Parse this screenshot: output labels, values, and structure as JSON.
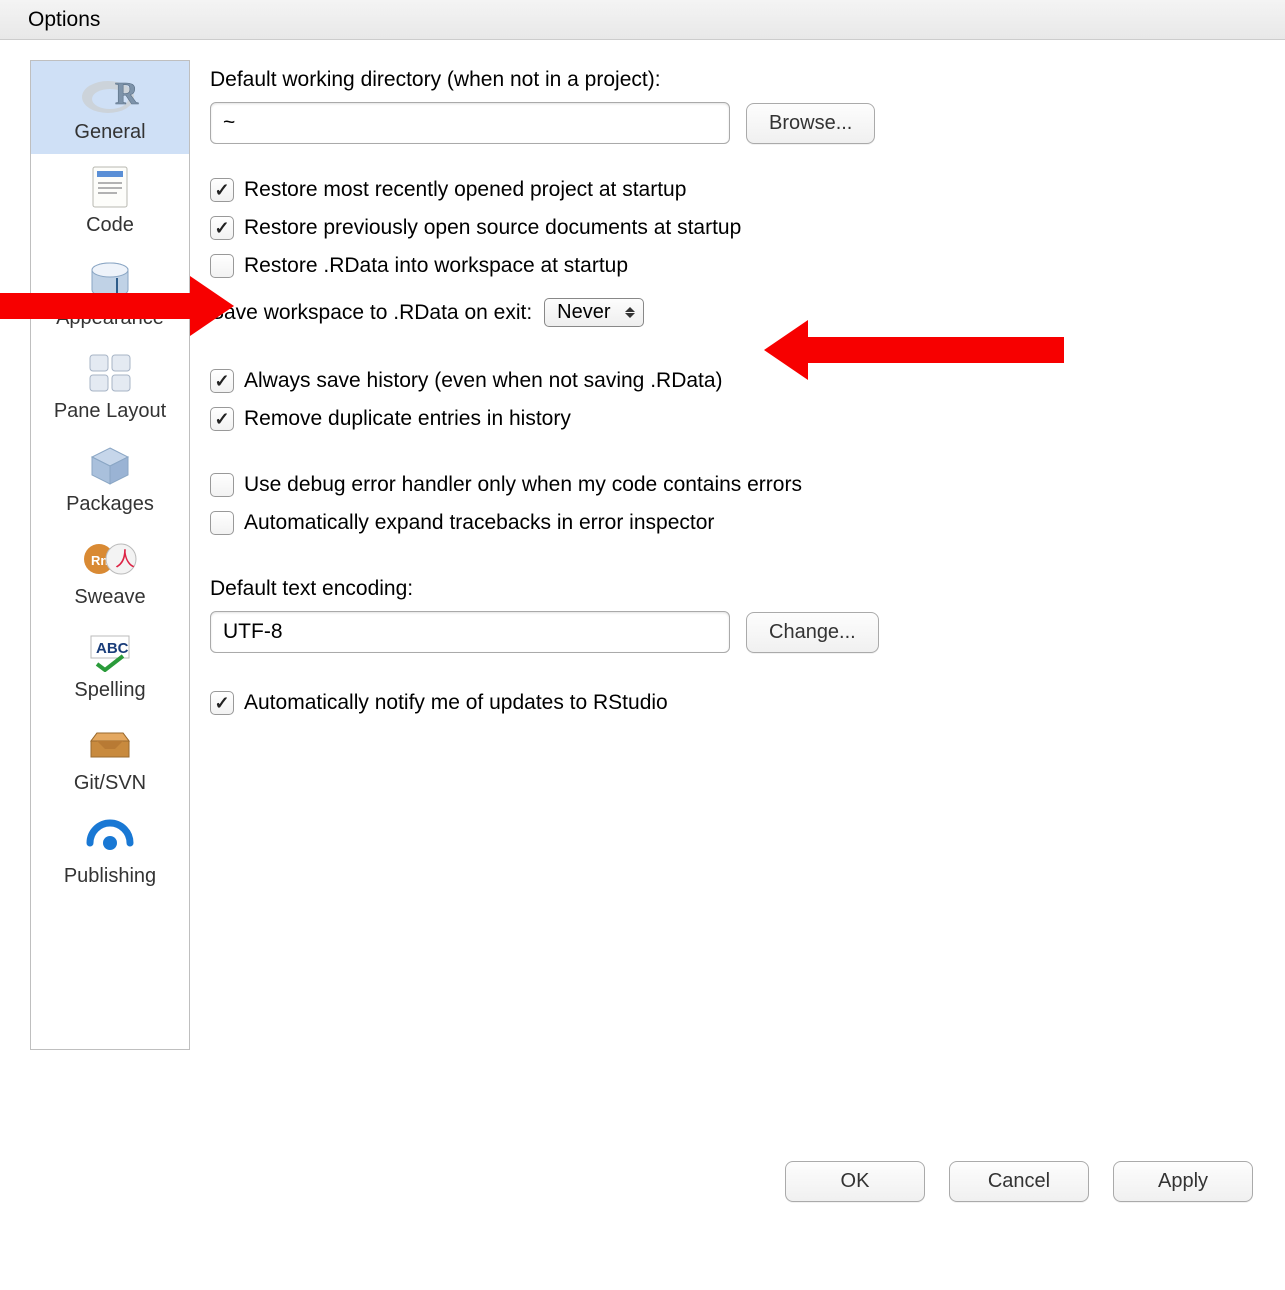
{
  "window": {
    "title": "Options"
  },
  "sidebar": {
    "items": [
      {
        "key": "general",
        "label": "General"
      },
      {
        "key": "code",
        "label": "Code"
      },
      {
        "key": "appearance",
        "label": "Appearance"
      },
      {
        "key": "pane-layout",
        "label": "Pane Layout"
      },
      {
        "key": "packages",
        "label": "Packages"
      },
      {
        "key": "sweave",
        "label": "Sweave"
      },
      {
        "key": "spelling",
        "label": "Spelling"
      },
      {
        "key": "gitsvn",
        "label": "Git/SVN"
      },
      {
        "key": "publishing",
        "label": "Publishing"
      }
    ]
  },
  "main": {
    "workingdir_label": "Default working directory (when not in a project):",
    "workingdir_value": "~",
    "browse_button": "Browse...",
    "cb_restore_project": "Restore most recently opened project at startup",
    "cb_restore_source": "Restore previously open source documents at startup",
    "cb_restore_rdata": "Restore .RData into workspace at startup",
    "save_workspace_label": "Save workspace to .RData on exit:",
    "save_workspace_value": "Never",
    "cb_save_history": "Always save history (even when not saving .RData)",
    "cb_remove_dup_history": "Remove duplicate entries in history",
    "cb_debug_handler": "Use debug error handler only when my code contains errors",
    "cb_expand_traceback": "Automatically expand tracebacks in error inspector",
    "encoding_label": "Default text encoding:",
    "encoding_value": "UTF-8",
    "change_button": "Change...",
    "cb_notify_updates": "Automatically notify me of updates to RStudio"
  },
  "footer": {
    "ok": "OK",
    "cancel": "Cancel",
    "apply": "Apply"
  }
}
